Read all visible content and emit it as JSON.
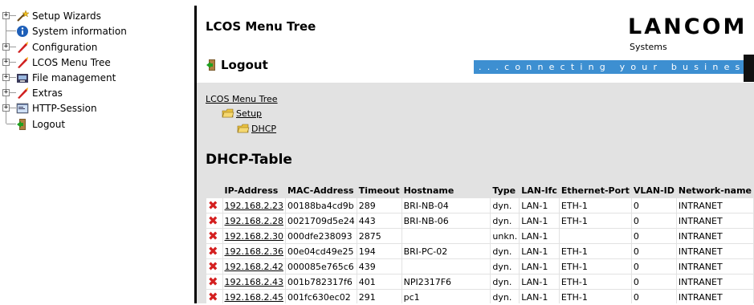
{
  "tree": {
    "items": [
      {
        "label": "Setup Wizards",
        "icon": "wizard-icon",
        "expandable": true
      },
      {
        "label": "System information",
        "icon": "info-icon",
        "expandable": false
      },
      {
        "label": "Configuration",
        "icon": "pointer-icon",
        "expandable": true
      },
      {
        "label": "LCOS Menu Tree",
        "icon": "pointer-icon",
        "expandable": true
      },
      {
        "label": "File management",
        "icon": "file-management-icon",
        "expandable": true
      },
      {
        "label": "Extras",
        "icon": "pointer-icon",
        "expandable": true
      },
      {
        "label": "HTTP-Session",
        "icon": "session-icon",
        "expandable": true
      },
      {
        "label": "Logout",
        "icon": "logout-icon",
        "expandable": false
      }
    ]
  },
  "header": {
    "title": "LCOS Menu Tree",
    "logo": "LANCOM",
    "logo_sub": "Systems",
    "logout_label": "Logout",
    "slogan": "...connecting your busines"
  },
  "breadcrumb": {
    "root": "LCOS Menu Tree",
    "level1": "Setup",
    "level2": "DHCP"
  },
  "page_title": "DHCP-Table",
  "table": {
    "columns": [
      "IP-Address",
      "MAC-Address",
      "Timeout",
      "Hostname",
      "Type",
      "LAN-Ifc",
      "Ethernet-Port",
      "VLAN-ID",
      "Network-name"
    ],
    "rows": [
      [
        "192.168.2.23",
        "00188ba4cd9b",
        "289",
        "BRI-NB-04",
        "dyn.",
        "LAN-1",
        "ETH-1",
        "0",
        "INTRANET"
      ],
      [
        "192.168.2.28",
        "0021709d5e24",
        "443",
        "BRI-NB-06",
        "dyn.",
        "LAN-1",
        "ETH-1",
        "0",
        "INTRANET"
      ],
      [
        "192.168.2.30",
        "000dfe238093",
        "2875",
        "",
        "unkn.",
        "LAN-1",
        "",
        "0",
        "INTRANET"
      ],
      [
        "192.168.2.36",
        "00e04cd49e25",
        "194",
        "BRI-PC-02",
        "dyn.",
        "LAN-1",
        "ETH-1",
        "0",
        "INTRANET"
      ],
      [
        "192.168.2.42",
        "000085e765c6",
        "439",
        "",
        "dyn.",
        "LAN-1",
        "ETH-1",
        "0",
        "INTRANET"
      ],
      [
        "192.168.2.43",
        "001b782317f6",
        "401",
        "NPI2317F6",
        "dyn.",
        "LAN-1",
        "ETH-1",
        "0",
        "INTRANET"
      ],
      [
        "192.168.2.45",
        "001fc630ec02",
        "291",
        "pc1",
        "dyn.",
        "LAN-1",
        "ETH-1",
        "0",
        "INTRANET"
      ]
    ]
  },
  "colors": {
    "accent_bar": "#3d8fd1",
    "delete_icon": "#d42020",
    "content_bg": "#e2e2e2"
  }
}
